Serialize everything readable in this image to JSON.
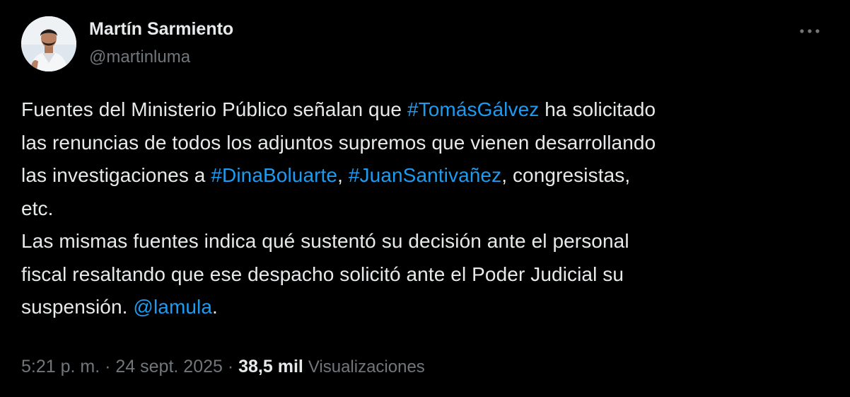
{
  "author": {
    "display_name": "Martín Sarmiento",
    "handle": "@martinluma"
  },
  "menu": {
    "icon": "more-horizontal-icon"
  },
  "tweet": {
    "lines": [
      [
        {
          "text": "Fuentes del Ministerio Público señalan que ",
          "type": "text"
        },
        {
          "text": "#TomásGálvez",
          "type": "hashtag"
        },
        {
          "text": " ha solicitado",
          "type": "text"
        }
      ],
      [
        {
          "text": "las renuncias de todos los adjuntos supremos que vienen desarrollando",
          "type": "text"
        }
      ],
      [
        {
          "text": "las investigaciones a ",
          "type": "text"
        },
        {
          "text": "#DinaBoluarte",
          "type": "hashtag"
        },
        {
          "text": ", ",
          "type": "text"
        },
        {
          "text": "#JuanSantivañez",
          "type": "hashtag"
        },
        {
          "text": ", congresistas,",
          "type": "text"
        }
      ],
      [
        {
          "text": "etc.",
          "type": "text"
        }
      ],
      [
        {
          "text": "Las mismas fuentes indica qué sustentó su decisión ante el personal",
          "type": "text"
        }
      ],
      [
        {
          "text": "fiscal resaltando que ese despacho solicitó ante el Poder Judicial su",
          "type": "text"
        }
      ],
      [
        {
          "text": "suspensión. ",
          "type": "text"
        },
        {
          "text": "@lamula",
          "type": "mention"
        },
        {
          "text": ".",
          "type": "text"
        }
      ]
    ]
  },
  "meta": {
    "time": "5:21 p. m.",
    "separator": " · ",
    "date": "24 sept. 2025",
    "views_count": "38,5 mil",
    "views_label": "Visualizaciones"
  },
  "colors": {
    "background": "#000000",
    "text": "#e7e9ea",
    "secondary": "#71767b",
    "link": "#1d9bf0"
  }
}
